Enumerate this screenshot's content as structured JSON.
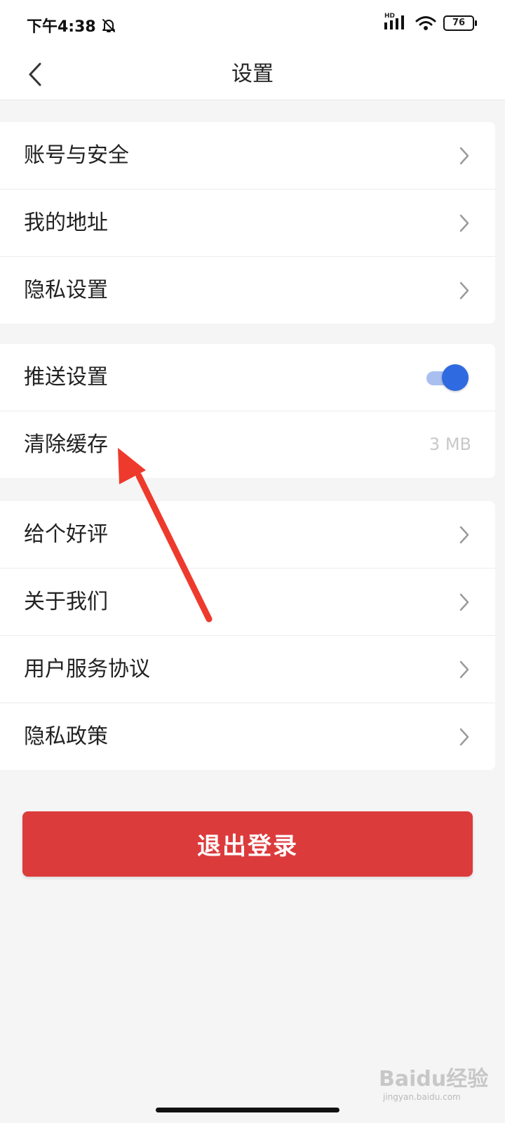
{
  "status_bar": {
    "time": "下午4:38",
    "hd_label": "HD",
    "battery": "76"
  },
  "header": {
    "title": "设置"
  },
  "groups": [
    {
      "items": [
        {
          "label": "账号与安全"
        },
        {
          "label": "我的地址"
        },
        {
          "label": "隐私设置"
        }
      ]
    },
    {
      "items": [
        {
          "label": "推送设置",
          "toggle_on": true
        },
        {
          "label": "清除缓存",
          "value": "3 MB"
        }
      ]
    },
    {
      "items": [
        {
          "label": "给个好评"
        },
        {
          "label": "关于我们"
        },
        {
          "label": "用户服务协议"
        },
        {
          "label": "隐私政策"
        }
      ]
    }
  ],
  "logout": {
    "label": "退出登录"
  },
  "watermark": {
    "logo": "Baidu经验",
    "sub": "jingyan.baidu.com"
  },
  "colors": {
    "accent_blue": "#2f6ae0",
    "logout_red": "#dc3b3c",
    "annotation_arrow": "#ee3a2c"
  }
}
